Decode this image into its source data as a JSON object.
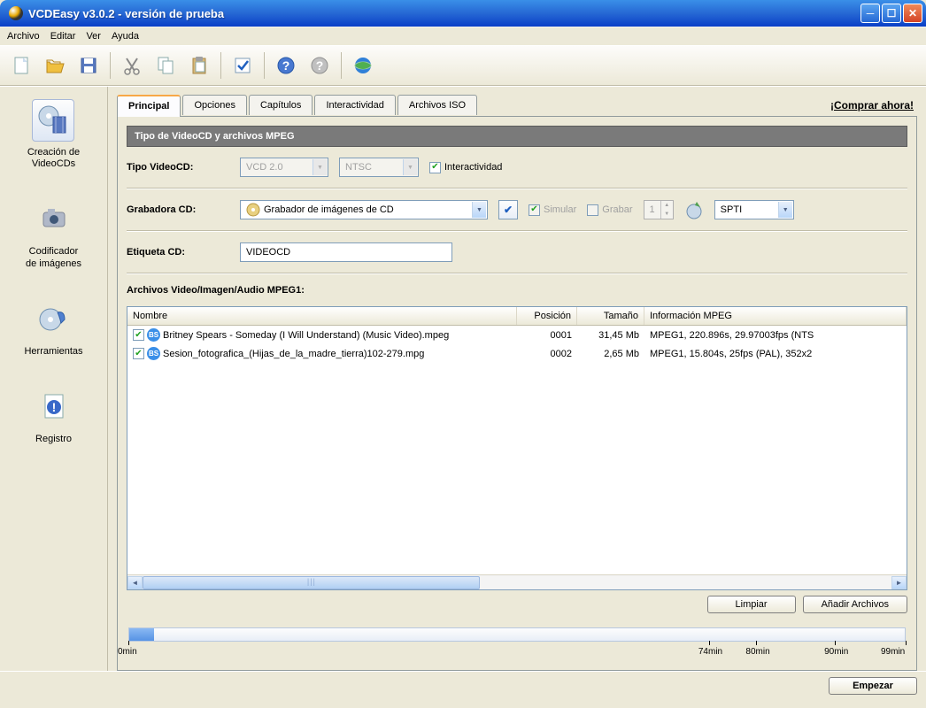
{
  "window": {
    "title": "VCDEasy v3.0.2 - versión de prueba"
  },
  "menu": {
    "archivo": "Archivo",
    "editar": "Editar",
    "ver": "Ver",
    "ayuda": "Ayuda"
  },
  "sidebar": {
    "items": [
      {
        "label": "Creación de\nVideoCDs"
      },
      {
        "label": "Codificador\nde imágenes"
      },
      {
        "label": "Herramientas"
      },
      {
        "label": "Registro"
      }
    ]
  },
  "tabs": {
    "items": [
      {
        "label": "Principal",
        "active": true
      },
      {
        "label": "Opciones"
      },
      {
        "label": "Capítulos"
      },
      {
        "label": "Interactividad"
      },
      {
        "label": "Archivos ISO"
      }
    ],
    "buy": "¡Comprar ahora!"
  },
  "section1": {
    "header": "Tipo de VideoCD y archivos MPEG"
  },
  "form": {
    "tipo_label": "Tipo VideoCD:",
    "tipo_format": "VCD 2.0",
    "tipo_norm": "NTSC",
    "interactividad": "Interactividad",
    "grabadora_label": "Grabadora CD:",
    "grabadora_value": "Grabador de imágenes de CD",
    "simular": "Simular",
    "grabar": "Grabar",
    "copies": "1",
    "driver": "SPTI",
    "etiqueta_label": "Etiqueta CD:",
    "etiqueta_value": "VIDEOCD",
    "archivos_label": "Archivos Video/Imagen/Audio MPEG1:"
  },
  "listview": {
    "cols": {
      "name": "Nombre",
      "pos": "Posición",
      "size": "Tamaño",
      "info": "Información MPEG"
    },
    "rows": [
      {
        "name": "Britney Spears - Someday (I Will Understand) (Music Video).mpeg",
        "pos": "0001",
        "size": "31,45 Mb",
        "info": "MPEG1, 220.896s, 29.97003fps (NTS"
      },
      {
        "name": "Sesion_fotografica_(Hijas_de_la_madre_tierra)102-279.mpg",
        "pos": "0002",
        "size": "2,65 Mb",
        "info": "MPEG1, 15.804s, 25fps (PAL), 352x2"
      }
    ]
  },
  "buttons": {
    "limpiar": "Limpiar",
    "anadir": "Añadir Archivos",
    "empezar": "Empezar"
  },
  "timeline": {
    "labels": {
      "t0": "0min",
      "t74": "74min",
      "t80": "80min",
      "t90": "90min",
      "t99": "99min"
    }
  }
}
